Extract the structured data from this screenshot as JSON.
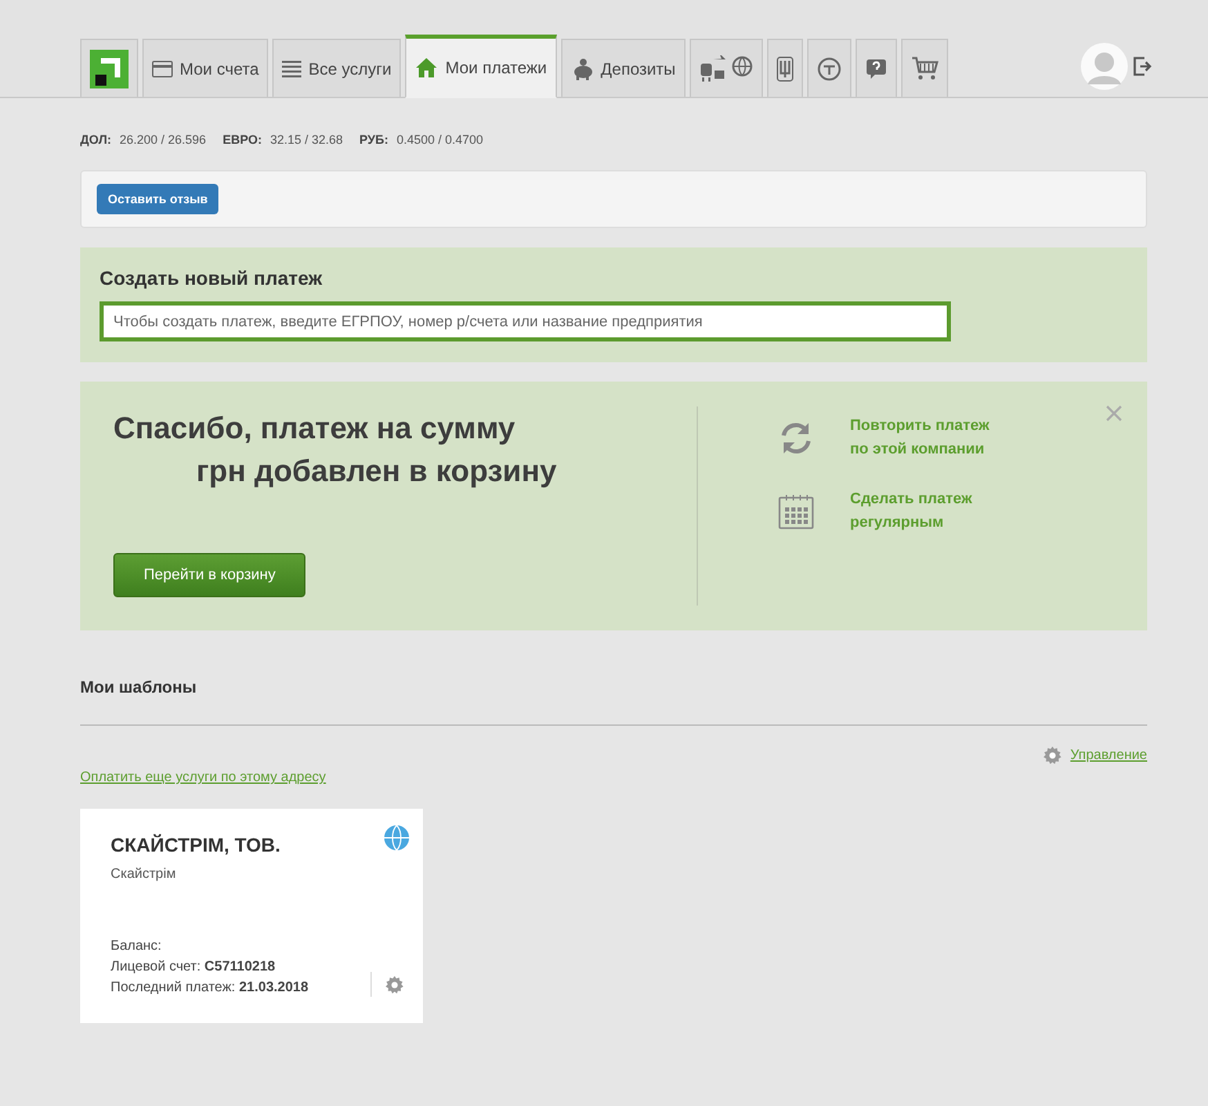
{
  "tabs": [
    {
      "kind": "logo",
      "selected": false
    },
    {
      "kind": "text",
      "label": "Мои счета",
      "selected": false
    },
    {
      "kind": "text",
      "label": "Все услуги",
      "selected": false
    },
    {
      "kind": "text",
      "label": "Мои платежи",
      "selected": true
    },
    {
      "kind": "text",
      "label": "Депозиты",
      "selected": false
    },
    {
      "kind": "icon",
      "selected": false
    },
    {
      "kind": "icon",
      "selected": false
    },
    {
      "kind": "icon",
      "selected": false
    },
    {
      "kind": "icon",
      "selected": false
    },
    {
      "kind": "icon",
      "selected": false
    }
  ],
  "rates": [
    {
      "currency": "ДОЛ:",
      "value": "26.200 / 26.596"
    },
    {
      "currency": "ЕВРО:",
      "value": "32.15 / 32.68"
    },
    {
      "currency": "РУБ:",
      "value": "0.4500 / 0.4700"
    }
  ],
  "feedback_button": "Оставить отзыв",
  "new_payment": {
    "title": "Создать новый платеж",
    "placeholder": "Чтобы создать платеж, введите ЕГРПОУ, номер р/счета или название предприятия"
  },
  "notice": {
    "message_line_1": "Спасибо,  платеж на сумму",
    "message_line_2": "грн  добавлен в корзину",
    "cart_button": "Перейти в корзину",
    "actions": [
      {
        "line_1": "Повторить платеж",
        "line_2": "по этой компании"
      },
      {
        "line_1": "Сделать платеж",
        "line_2": "регулярным"
      }
    ]
  },
  "templates": {
    "title": "Мои шаблоны",
    "manage_link": "Управление",
    "pay_more_link": "Оплатить еще услуги по этому адресу",
    "cards": [
      {
        "name": "СКАЙСТРІМ, ТОВ.",
        "subtitle": "Скайстрім",
        "details": [
          "Баланс:",
          "Лицевой счет: **C57110218**",
          "Последний платеж: **21.03.2018**"
        ]
      }
    ]
  }
}
